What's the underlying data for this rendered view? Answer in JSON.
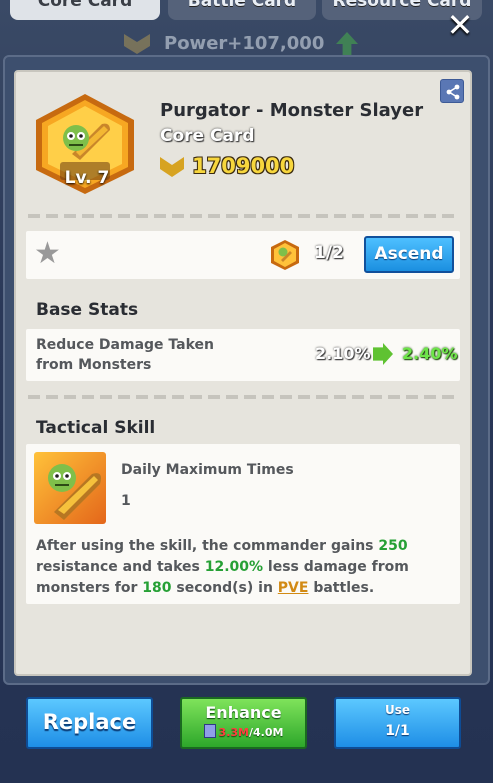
{
  "tabs": [
    "Core Card",
    "Battle Card",
    "Resource Card"
  ],
  "power_banner": "Power+107,000",
  "card": {
    "name": "Purgator - Monster Slayer",
    "type": "Core Card",
    "level": "Lv. 7",
    "power": "1709000"
  },
  "ascend": {
    "count": "1/2",
    "button": "Ascend"
  },
  "base_stats": {
    "title": "Base Stats",
    "name": "Reduce Damage Taken from Monsters",
    "from": "2.10%",
    "to": "2.40%"
  },
  "skill": {
    "title": "Tactical Skill",
    "label": "Daily Maximum Times",
    "value": "1",
    "desc": {
      "a": "After using the skill, the commander gains ",
      "v1": "250",
      "b": " resistance and takes ",
      "v2": "12.00%",
      "c": " less damage from monsters for ",
      "v3": "180",
      "d": " second(s) in ",
      "v4": "PVE",
      "e": " battles."
    }
  },
  "buttons": {
    "replace": "Replace",
    "enhance": "Enhance",
    "enhance_have": "3.3M",
    "enhance_need": "/4.0M",
    "use": "Use",
    "use_count": "1/1"
  },
  "colors": {
    "accent_blue": "#1e8ee6",
    "accent_green": "#2da72b",
    "highlight_green": "#26a035",
    "pve_orange": "#d28a14"
  }
}
